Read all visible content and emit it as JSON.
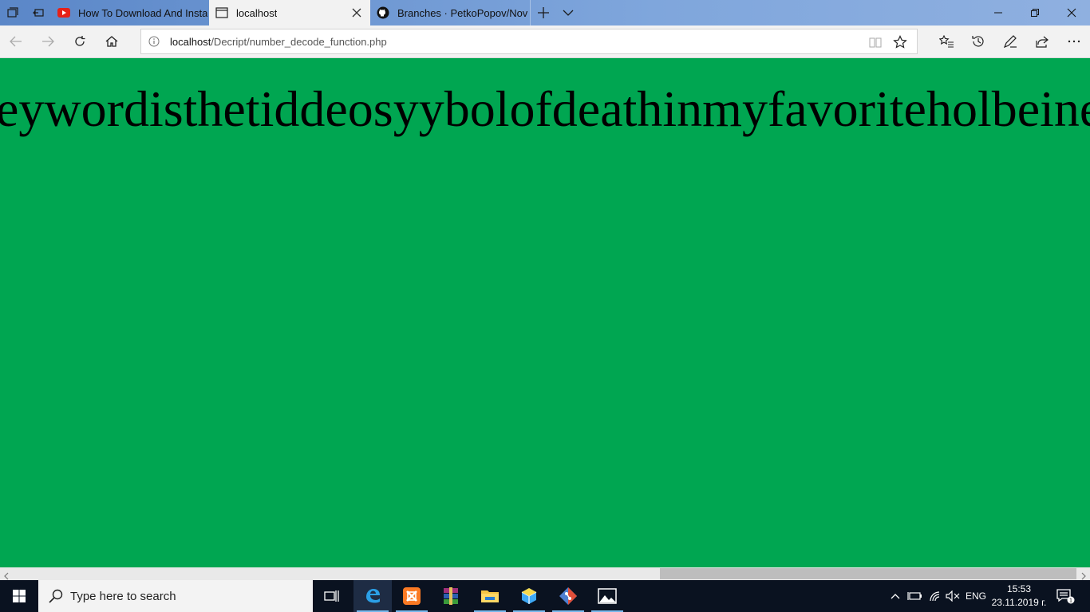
{
  "browser": {
    "tabs": [
      {
        "label": "How To Download And Insta",
        "icon": "youtube-icon"
      },
      {
        "label": "localhost",
        "icon": "page-icon",
        "active": true
      },
      {
        "label": "Branches · PetkoPopov/Nov",
        "icon": "github-icon"
      }
    ],
    "address": {
      "host": "localhost",
      "path": "/Decript/number_decode_function.php"
    }
  },
  "page": {
    "background": "#00a651",
    "decoded_text": "keywordisthetiddeosyybolofdeathinmyfavoriteholbeinend"
  },
  "taskbar": {
    "search_placeholder": "Type here to search",
    "language": "ENG",
    "time": "15:53",
    "date": "23.11.2019 г.",
    "notification_count": "1"
  },
  "colors": {
    "tabbar": "#6f97d2",
    "page_bg": "#00a651",
    "taskbar": "#0a1220",
    "accent": "#0078d7"
  }
}
